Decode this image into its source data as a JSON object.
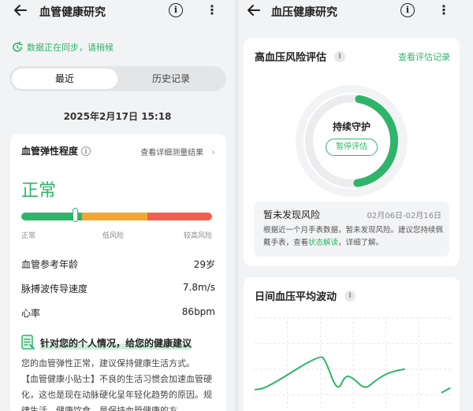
{
  "left": {
    "title": "血管健康研究",
    "sync_text": "数据正在同步，请稍候",
    "tabs": [
      "最近",
      "历史记录"
    ],
    "date": "2025年2月17日 15:18",
    "elasticity": {
      "label": "血管弹性程度",
      "detail_link": "查看详细测量结果",
      "status": "正常",
      "level_fraction": 0.28,
      "scale_labels": [
        "正常",
        "低风险",
        "较高风险"
      ]
    },
    "metrics": [
      {
        "label": "血管参考年龄",
        "value": "29岁"
      },
      {
        "label": "脉搏波传导速度",
        "value": "7.8m/s"
      },
      {
        "label": "心率",
        "value": "86bpm"
      }
    ],
    "advice": {
      "title": "针对您的个人情况，给您的健康建议",
      "line1": "您的血管弹性正常，建议保持健康生活方式。",
      "line2": "【血管健康小贴士】不良的生活习惯会加速血管硬化，这也是现在动脉硬化呈年轻化趋势的原因。规律生活、健康饮食，是保持血管健康的方"
    }
  },
  "right": {
    "title": "血压健康研究",
    "risk_card": {
      "title": "高血压风险评估",
      "link": "查看评估记录",
      "ring_status": "持续守护",
      "pause_button": "暂停评估",
      "progress_fraction": 0.45,
      "result_title": "暂未发现风险",
      "result_dates": "02月06日-02月16日",
      "result_body_pre": "根据近一个月手表数据，暂未发现风险。建议您持续佩戴手表，查看",
      "result_body_link": "状态解读",
      "result_body_post": "，详细了解。"
    },
    "fluctuation_card": {
      "title": "日间血压平均波动"
    }
  },
  "colors": {
    "accent": "#2fb56a",
    "warn": "#f5a431",
    "danger": "#f25f4f"
  },
  "chart_data": {
    "type": "line",
    "title": "日间血压平均波动",
    "series": [
      {
        "values": [
          {
            "x": 0,
            "y": 40
          },
          {
            "x": 0.06,
            "y": 42
          },
          {
            "x": 0.33,
            "y": 88
          },
          {
            "x": 0.36,
            "y": 80
          },
          {
            "x": 0.42,
            "y": 36
          },
          {
            "x": 0.46,
            "y": 60
          },
          {
            "x": 0.5,
            "y": 56
          },
          {
            "x": 0.56,
            "y": 40
          },
          {
            "x": 0.61,
            "y": 52
          },
          {
            "x": 0.67,
            "y": 62
          },
          {
            "x": 0.72,
            "y": 66
          },
          {
            "x": 0.76,
            "y": 68
          }
        ]
      },
      {
        "values": [
          {
            "x": 0.95,
            "y": 36
          },
          {
            "x": 0.99,
            "y": 42
          }
        ]
      }
    ],
    "ylim": [
      0,
      140
    ],
    "grid": true
  }
}
